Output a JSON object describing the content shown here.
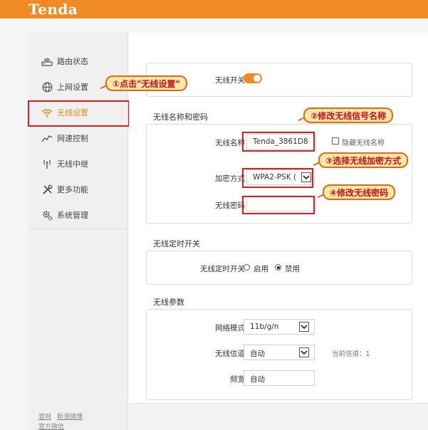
{
  "brand": {
    "logo": "Tenda"
  },
  "sidebar": {
    "items": [
      {
        "label": "路由状态",
        "icon": "router-status-icon"
      },
      {
        "label": "上网设置",
        "icon": "globe-icon"
      },
      {
        "label": "无线设置",
        "icon": "wifi-icon",
        "active": true
      },
      {
        "label": "网速控制",
        "icon": "speed-chart-icon"
      },
      {
        "label": "无线中继",
        "icon": "antenna-icon"
      },
      {
        "label": "更多功能",
        "icon": "tools-icon"
      },
      {
        "label": "系统管理",
        "icon": "gear-icon"
      }
    ],
    "footer": [
      "官网",
      "新浪微博",
      "官方微信"
    ]
  },
  "wifi_switch": {
    "label": "无线开关",
    "enabled": true
  },
  "ssid_section": {
    "title": "无线名称和密码",
    "name_label": "无线名称",
    "name_value": "Tenda_3861D8",
    "hide_label": "隐藏无线名称",
    "encryption_label": "加密方式",
    "encryption_value": "WPA2-PSK (",
    "password_label": "无线密码",
    "password_value": ""
  },
  "schedule_section": {
    "title": "无线定时开关",
    "label": "无线定时开关",
    "options": [
      "启用",
      "禁用"
    ],
    "selected": "禁用"
  },
  "params_section": {
    "title": "无线参数",
    "mode_label": "网络模式",
    "mode_value": "11b/g/n",
    "channel_label": "无线信道",
    "channel_value": "自动",
    "current_channel": "当前信道：1",
    "bandwidth_label": "频宽",
    "bandwidth_value": "自动"
  },
  "annotations": {
    "step1": "①点击\"无线设置\"",
    "step2": "②修改无线信号名称",
    "step3": "③选择无线加密方式",
    "step4": "④修改无线密码"
  },
  "colors": {
    "accent": "#f08a24",
    "annotation_red": "#d81e1e",
    "callout_fill": "#fde6a6"
  }
}
